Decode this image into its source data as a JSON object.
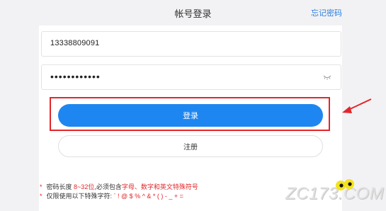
{
  "header": {
    "title": "帐号登录",
    "forgot_link": "忘记密码"
  },
  "form": {
    "phone_value": "13338809091",
    "password_mask": "••••••••••••",
    "login_label": "登录",
    "register_label": "注册"
  },
  "rules": {
    "line1_prefix": "密码长度",
    "line1_range": "8~32位",
    "line1_middle": ",必须包含",
    "line1_types": "字母、数字和英文特殊符号",
    "line2_prefix": "仅限使用以下特殊字符:",
    "line2_chars": "` ! @ $ % ^ & * ( ) - _ + ="
  },
  "watermark": {
    "text": "ZC173.COM"
  },
  "colors": {
    "primary": "#1e86f0",
    "highlight": "#e3262a",
    "link": "#2a7fe0"
  },
  "icons": {
    "eye": "eye-closed-icon",
    "arrow": "annotation-arrow"
  }
}
